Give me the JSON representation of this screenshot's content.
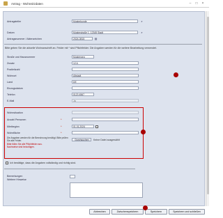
{
  "window": {
    "title": "Antrag - Wohnsitzdaten",
    "minimize": "–",
    "maximize": "□",
    "close": "×"
  },
  "top": {
    "rows": [
      {
        "label": "Antragsteller",
        "value": "Musterkunde"
      },
      {
        "label": "Datum",
        "value": "Musterstraße 1, 12345 Stadt"
      },
      {
        "label": "Antragsnummer / Aktenzeichen",
        "value": "2024-0815"
      }
    ]
  },
  "intro": "Bitte geben Sie die aktuelle Wohnanschrift an. Felder mit * sind Pflichtfelder. Die Angaben werden für die weitere Bearbeitung verwendet.",
  "address": {
    "rows": [
      {
        "label": "Straße und Hausnummer",
        "value": "Musterweg"
      },
      {
        "label": "Zusatz",
        "value": "12 A"
      },
      {
        "label": "Postleitzahl",
        "value": ""
      },
      {
        "label": "Wohnort",
        "value": "Altstadt"
      },
      {
        "label": "Land",
        "value": "DE"
      },
      {
        "label": "Einzugsdatum",
        "value": ""
      },
      {
        "label": "Telefon",
        "value": "0123 4567"
      },
      {
        "label": "E-Mail",
        "value": "Ja"
      }
    ]
  },
  "section2": {
    "rows": [
      {
        "label": "Wohnsituation",
        "value": ""
      },
      {
        "label": "Anzahl Personen",
        "value": ""
      },
      {
        "label": "Mietbeginn",
        "value": "01.01.2024"
      },
      {
        "label": "Wohnfläche",
        "value": ""
      }
    ],
    "note": "Die Angaben werden für die Berechnung benötigt. Bitte prüfen Sie alle Felder.",
    "red_notes": [
      "Bitte füllen Sie alle Pflichtfelder aus.",
      "Nachweise sind beizufügen."
    ],
    "upload_label": "Durchsuchen",
    "upload_hint": "Keine Datei ausgewählt"
  },
  "consent": "Ich bestätige, dass die Angaben vollständig und richtig sind.",
  "comment": {
    "label1": "Bemerkungen",
    "label2": "Weitere Hinweise"
  },
  "buttons": {
    "back": "Abbrechen",
    "save_draft": "Zwischenspeichern",
    "save": "Speichern",
    "save_close": "Speichern und schließen"
  }
}
